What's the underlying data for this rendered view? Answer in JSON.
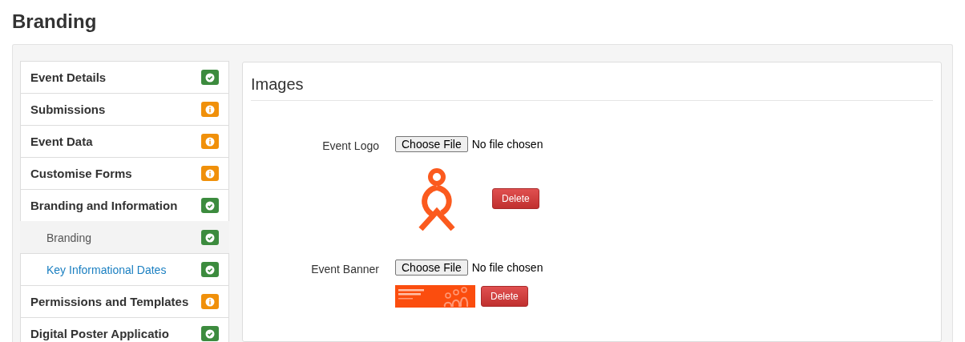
{
  "page_title": "Branding",
  "sidebar": {
    "items": [
      {
        "label": "Event Details",
        "kind": "complete",
        "selected": false
      },
      {
        "label": "Submissions",
        "kind": "info",
        "selected": false
      },
      {
        "label": "Event Data",
        "kind": "info",
        "selected": false
      },
      {
        "label": "Customise Forms",
        "kind": "info",
        "selected": false
      },
      {
        "label": "Branding and Information",
        "kind": "complete",
        "selected": false,
        "children": [
          {
            "label": "Branding",
            "kind": "complete",
            "selected": true
          },
          {
            "label": "Key Informational Dates",
            "kind": "complete",
            "selected": false
          }
        ]
      },
      {
        "label": "Permissions and Templates",
        "kind": "info",
        "selected": false
      },
      {
        "label": "Digital Poster Applicatio",
        "kind": "complete",
        "selected": false
      }
    ]
  },
  "panel": {
    "title": "Images",
    "fields": [
      {
        "label": "Event Logo",
        "button": "Choose File",
        "file_status": "No file chosen",
        "kind": "logo",
        "delete": "Delete"
      },
      {
        "label": "Event Banner",
        "button": "Choose File",
        "file_status": "No file chosen",
        "kind": "banner",
        "delete": "Delete"
      }
    ]
  }
}
